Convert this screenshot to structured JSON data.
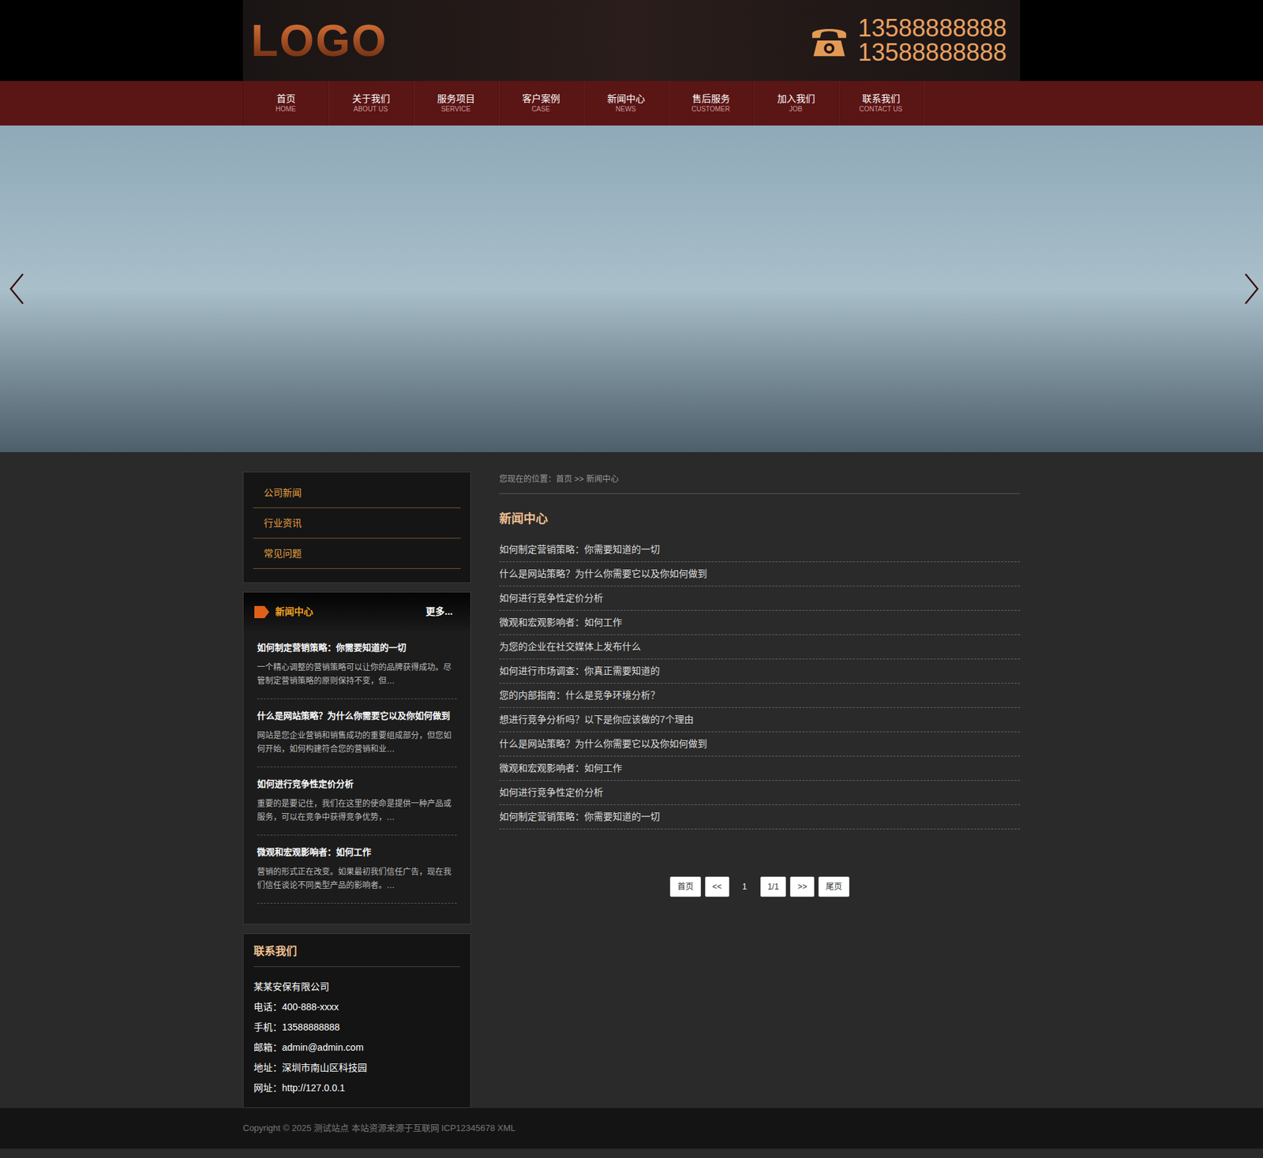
{
  "header": {
    "logo": "LOGO",
    "phones": [
      "13588888888",
      "13588888888"
    ]
  },
  "nav": [
    {
      "label": "首页",
      "sub": "HOME"
    },
    {
      "label": "关于我们",
      "sub": "ABOUT US"
    },
    {
      "label": "服务项目",
      "sub": "SERVICE"
    },
    {
      "label": "客户案例",
      "sub": "CASE"
    },
    {
      "label": "新闻中心",
      "sub": "NEWS"
    },
    {
      "label": "售后服务",
      "sub": "CUSTOMER"
    },
    {
      "label": "加入我们",
      "sub": "JOB"
    },
    {
      "label": "联系我们",
      "sub": "CONTACT US"
    }
  ],
  "sidebar": {
    "categories": [
      "公司新闻",
      "行业资讯",
      "常见问题"
    ],
    "news": {
      "title": "新闻中心",
      "more": "更多...",
      "items": [
        {
          "title": "如何制定营销策略：你需要知道的一切",
          "summary": "一个精心调整的营销策略可以让你的品牌获得成功。尽管制定营销策略的原则保持不变，但…"
        },
        {
          "title": "什么是网站策略？为什么你需要它以及你如何做到",
          "summary": "网站是您企业营销和销售成功的重要组成部分，但您如何开始，如何构建符合您的营销和业…"
        },
        {
          "title": "如何进行竞争性定价分析",
          "summary": "重要的是要记住，我们在这里的使命是提供一种产品或服务，可以在竞争中获得竞争优势，…"
        },
        {
          "title": "微观和宏观影响者：如何工作",
          "summary": "营销的形式正在改变。如果最初我们信任广告，现在我们信任谈论不同类型产品的影响者。…"
        }
      ]
    },
    "contact": {
      "title": "联系我们",
      "lines": [
        "某某安保有限公司",
        "电话：400-888-xxxx",
        "手机：13588888888",
        "邮箱：admin@admin.com",
        "地址：深圳市南山区科技园",
        "网址：http://127.0.0.1"
      ]
    }
  },
  "main": {
    "breadcrumb": "您现在的位置：首页 >> 新闻中心",
    "title": "新闻中心",
    "items": [
      "如何制定营销策略：你需要知道的一切",
      "什么是网站策略？为什么你需要它以及你如何做到",
      "如何进行竞争性定价分析",
      "微观和宏观影响者：如何工作",
      "为您的企业在社交媒体上发布什么",
      "如何进行市场调查：你真正需要知道的",
      "您的内部指南：什么是竞争环境分析？",
      "想进行竞争分析吗？以下是你应该做的7个理由",
      "什么是网站策略？为什么你需要它以及你如何做到",
      "微观和宏观影响者：如何工作",
      "如何进行竞争性定价分析",
      "如何制定营销策略：你需要知道的一切"
    ],
    "pagination": [
      {
        "label": "首页",
        "selected": false
      },
      {
        "label": "<<",
        "selected": false
      },
      {
        "label": "1",
        "selected": true
      },
      {
        "label": "1/1",
        "selected": false
      },
      {
        "label": ">>",
        "selected": false
      },
      {
        "label": "尾页",
        "selected": false
      }
    ]
  },
  "footer": "Copyright © 2025 测试站点 本站资源来源于互联网 ICP12345678 XML"
}
